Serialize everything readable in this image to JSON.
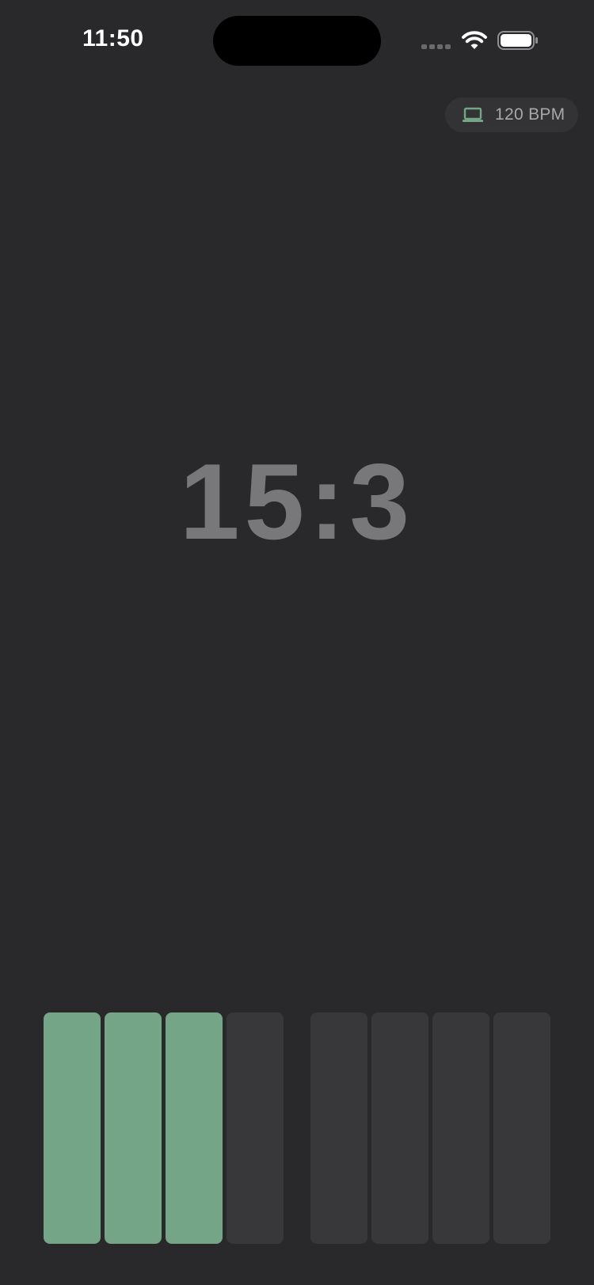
{
  "status_bar": {
    "time": "11:50"
  },
  "tempo": {
    "label": "120 BPM",
    "icon": "laptop-icon"
  },
  "counter": {
    "value": "15:3"
  },
  "beats": {
    "total": 8,
    "active": 3,
    "active_color": "#74a587",
    "inactive_color": "#38383a"
  },
  "colors": {
    "background": "#29292b",
    "counter_text": "#78787b"
  }
}
